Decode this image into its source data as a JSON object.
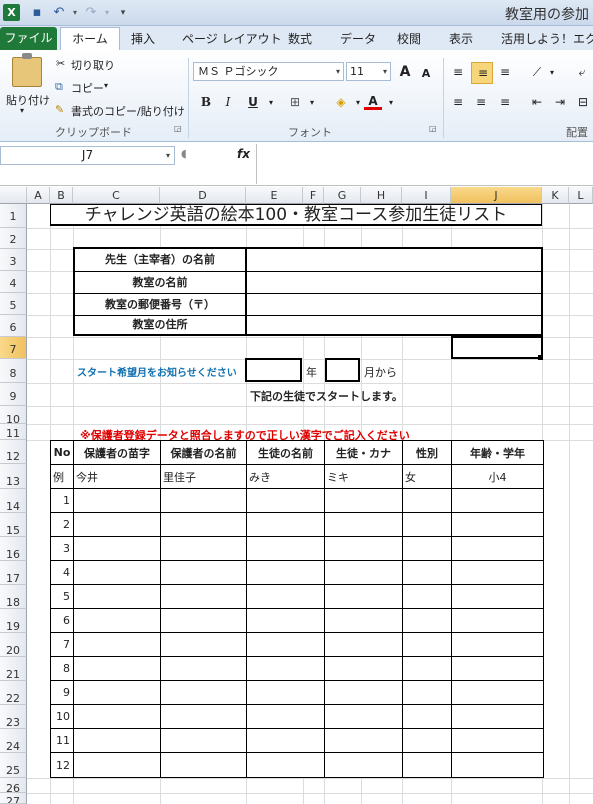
{
  "app": {
    "title": "教室用の参加"
  },
  "ribbon_tabs": {
    "file": "ファイル",
    "home": "ホーム",
    "insert": "挿入",
    "layout": "ページ レイアウト",
    "formulas": "数式",
    "data": "データ",
    "review": "校閲",
    "view": "表示",
    "addin": "活用しよう！エクセル"
  },
  "clipboard": {
    "paste": "貼り付け",
    "cut": "切り取り",
    "copy": "コピー",
    "format_painter": "書式のコピー/貼り付け",
    "group": "クリップボード"
  },
  "font": {
    "name": "ＭＳ Ｐゴシック",
    "size": "11",
    "group": "フォント",
    "grow": "A",
    "shrink": "A",
    "bold": "B",
    "italic": "I",
    "underline": "U",
    "font_color_letter": "A"
  },
  "alignment": {
    "group": "配置"
  },
  "namebox": "J7",
  "fx": "fx",
  "columns": [
    "A",
    "B",
    "C",
    "D",
    "E",
    "F",
    "G",
    "H",
    "I",
    "J",
    "K",
    "L"
  ],
  "rows": [
    "1",
    "2",
    "3",
    "4",
    "5",
    "6",
    "7",
    "8",
    "9",
    "10",
    "11",
    "12",
    "13",
    "14",
    "15",
    "16",
    "17",
    "18",
    "19",
    "20",
    "21",
    "22",
    "23",
    "24",
    "25",
    "26",
    "27"
  ],
  "sheet": {
    "title": "チャレンジ英語の絵本100・教室コース参加生徒リスト",
    "info_labels": [
      "先生（主宰者）の名前",
      "教室の名前",
      "教室の郵便番号（〒）",
      "教室の住所"
    ],
    "start_prompt": "スタート希望月をお知らせください",
    "year": "年",
    "month_from": "月から",
    "start_note": "下記の生徒でスタートします。",
    "warning": "※保護者登録データと照合しますので正しい漢字でご記入ください",
    "table_headers": [
      "No",
      "保護者の苗字",
      "保護者の名前",
      "生徒の名前",
      "生徒・カナ",
      "性別",
      "年齢・学年"
    ],
    "example": [
      "例",
      "今井",
      "里佳子",
      "みき",
      "ミキ",
      "女",
      "小4"
    ],
    "numbers": [
      "1",
      "2",
      "3",
      "4",
      "5",
      "6",
      "7",
      "8",
      "9",
      "10",
      "11",
      "12"
    ]
  }
}
